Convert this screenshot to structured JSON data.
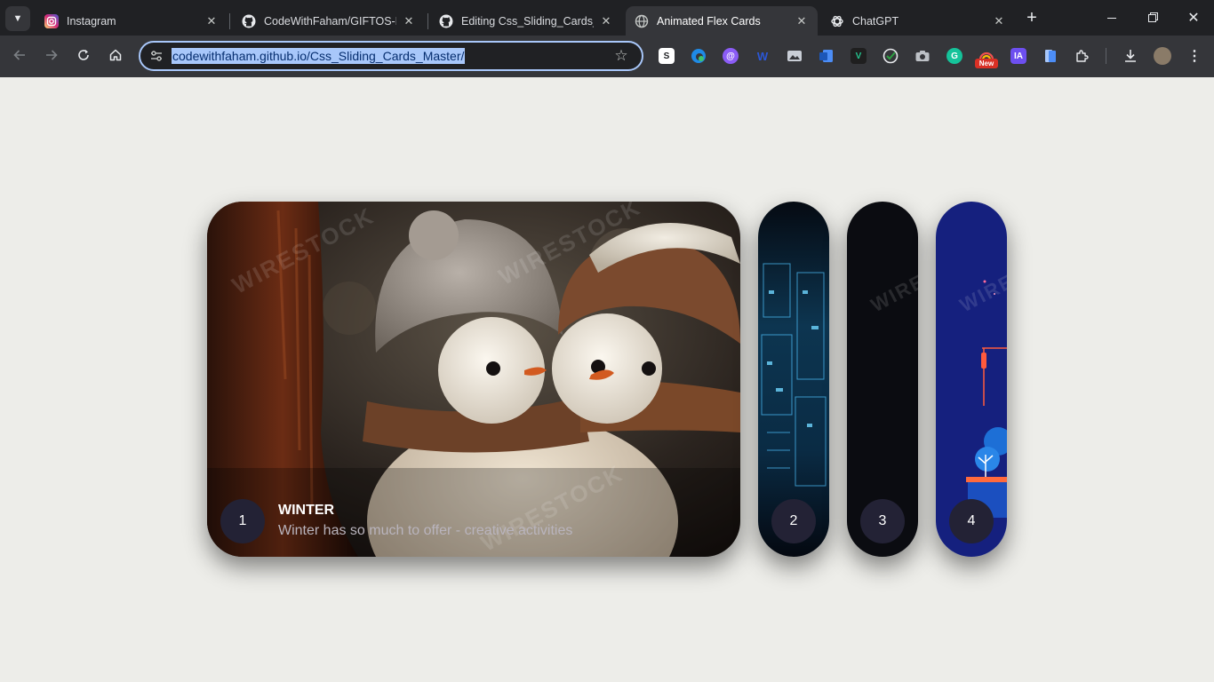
{
  "browser": {
    "tabs": [
      {
        "title": "Instagram",
        "icon": "instagram-icon",
        "active": false
      },
      {
        "title": "CodeWithFaham/GIFTOS-DY",
        "icon": "github-icon",
        "active": false
      },
      {
        "title": "Editing Css_Sliding_Cards_M",
        "icon": "github-icon",
        "active": false
      },
      {
        "title": "Animated Flex Cards",
        "icon": "globe-icon",
        "active": true
      },
      {
        "title": "ChatGPT",
        "icon": "chatgpt-icon",
        "active": false
      }
    ],
    "address": "codewithfaham.github.io/Css_Sliding_Cards_Master/",
    "extensions": [
      {
        "name": "s-extension-icon",
        "label": "S",
        "color": "#ffffff"
      },
      {
        "name": "edge-extension-icon",
        "label": "",
        "color": "#1f8ae6"
      },
      {
        "name": "at-extension-icon",
        "label": "@",
        "color": "#8b5cf6"
      },
      {
        "name": "w-extension-icon",
        "label": "W",
        "color": "#2b57d6"
      },
      {
        "name": "photo-extension-icon",
        "label": "",
        "color": "#c9ced6"
      },
      {
        "name": "word-extension-icon",
        "label": "",
        "color": "#2b6ccc"
      },
      {
        "name": "v-extension-icon",
        "label": "V",
        "color": "#24c48e"
      },
      {
        "name": "check-extension-icon",
        "label": "",
        "color": "#2ea043"
      },
      {
        "name": "camera-extension-icon",
        "label": "",
        "color": "#bdc1c6"
      },
      {
        "name": "grammarly-extension-icon",
        "label": "G",
        "color": "#15c39a"
      },
      {
        "name": "rainbow-extension-icon",
        "label": "",
        "color": "#f0524f"
      },
      {
        "name": "ia-extension-icon",
        "label": "IA",
        "color": "#6d4ff0"
      },
      {
        "name": "docs-extension-icon",
        "label": "",
        "color": "#4c8df6"
      }
    ],
    "new_badge": "New"
  },
  "cards": [
    {
      "number": "1",
      "title": "WINTER",
      "subtitle": "Winter has so much to offer - creative activities",
      "expanded": true
    },
    {
      "number": "2",
      "expanded": false
    },
    {
      "number": "3",
      "expanded": false
    },
    {
      "number": "4",
      "expanded": false
    }
  ],
  "watermark_text": "WIRESTOCK",
  "colors": {
    "page_bg": "#edede9",
    "number_circle": "#232235",
    "subtitle": "#b9b4bd",
    "omnibox_highlight": "#a8c7fa"
  }
}
